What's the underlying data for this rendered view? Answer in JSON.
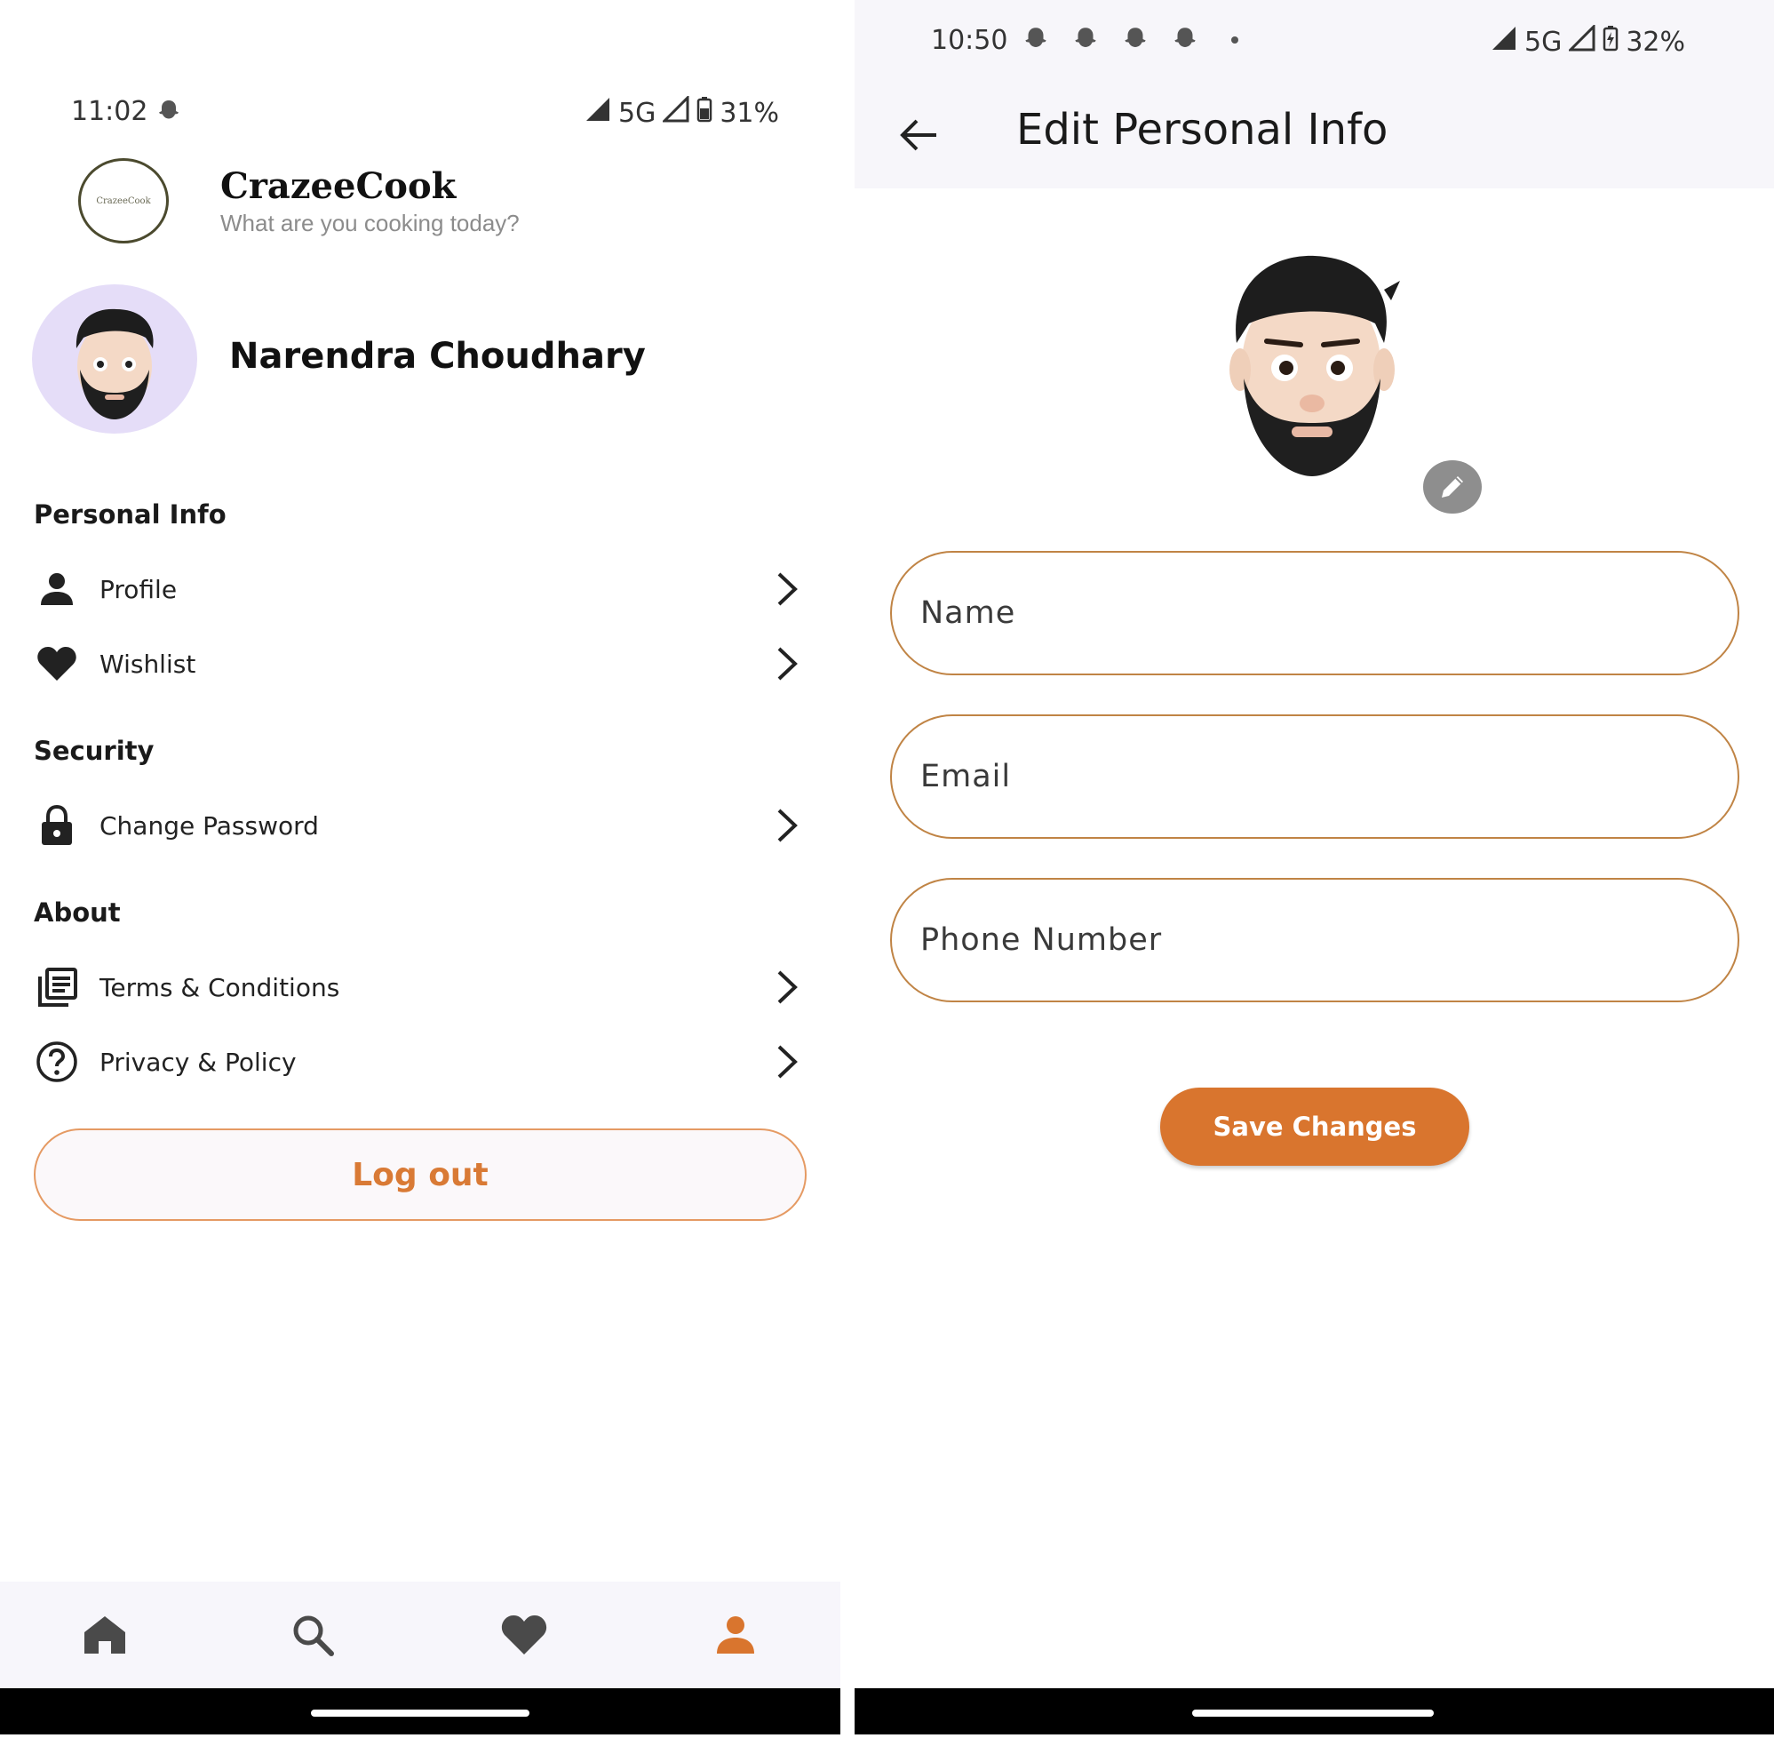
{
  "left_screen": {
    "status_bar": {
      "time": "11:02",
      "network": "5G",
      "battery": "31%"
    },
    "header": {
      "app_name": "CrazeeCook",
      "tagline": "What are you cooking today?",
      "logo_text": "CrazeeCook"
    },
    "user": {
      "name": "Narendra Choudhary"
    },
    "sections": {
      "personal_info": "Personal Info",
      "security": "Security",
      "about": "About"
    },
    "items": {
      "profile": "Profile",
      "wishlist": "Wishlist",
      "change_password": "Change Password",
      "terms": "Terms & Conditions",
      "privacy": "Privacy & Policy"
    },
    "logout_label": "Log out",
    "bottom_nav": {
      "active": "profile",
      "active_color": "#d9752e",
      "inactive_color": "#4a4a4a"
    }
  },
  "right_screen": {
    "status_bar": {
      "time": "10:50",
      "network": "5G",
      "battery": "32%"
    },
    "title": "Edit Personal Info",
    "fields": {
      "name_placeholder": "Name",
      "email_placeholder": "Email",
      "phone_placeholder": "Phone Number"
    },
    "save_label": "Save Changes"
  },
  "colors": {
    "accent": "#d9752e",
    "field_border": "#c08445",
    "avatar_bg": "#e5ddf8"
  }
}
